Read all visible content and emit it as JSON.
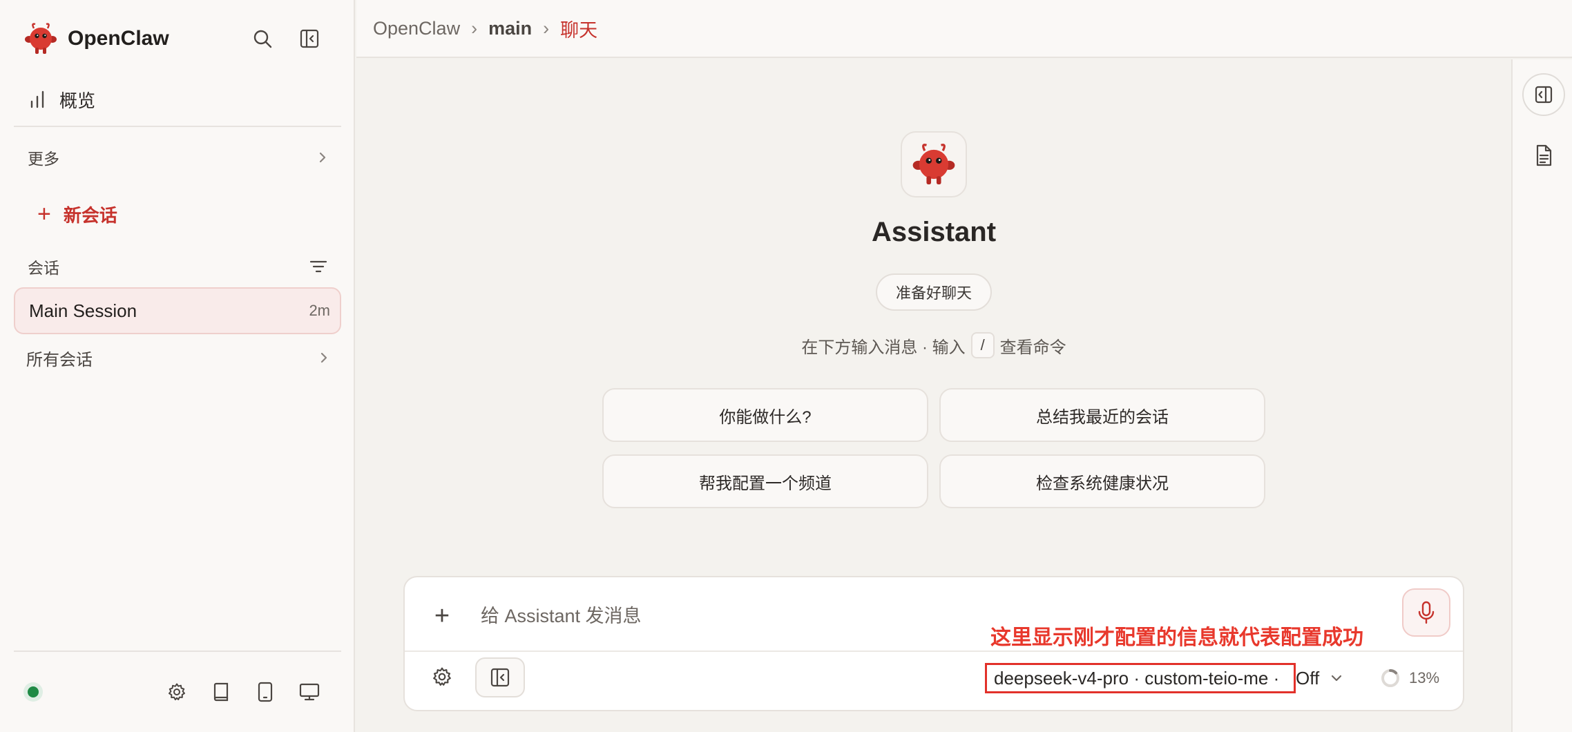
{
  "app": {
    "name": "OpenClaw"
  },
  "sidebar": {
    "overview_label": "概览",
    "more_label": "更多",
    "new_chat_label": "新会话",
    "sessions_header": "会话",
    "session": {
      "title": "Main Session",
      "age": "2m"
    },
    "all_sessions_label": "所有会话",
    "status_color": "#1f8a45"
  },
  "breadcrumb": {
    "root": "OpenClaw",
    "agent": "main",
    "page": "聊天"
  },
  "welcome": {
    "assistant_name": "Assistant",
    "status_pill": "准备好聊天",
    "hint_before": "在下方输入消息 · 输入",
    "hint_key": "/",
    "hint_after": "查看命令",
    "suggestions": [
      "你能做什么?",
      "总结我最近的会话",
      "帮我配置一个频道",
      "检查系统健康状况"
    ]
  },
  "composer": {
    "placeholder": "给 Assistant 发消息",
    "model_info": "deepseek-v4-pro · custom-teio-me ·",
    "thinking": "Off",
    "context_usage": "13%",
    "context_fraction": 0.13,
    "annotation": "这里显示刚才配置的信息就代表配置成功"
  },
  "colors": {
    "accent": "#c6322c",
    "annotation": "#e8382c"
  },
  "icons": [
    "openclaw-logo-icon",
    "search-icon",
    "sidebar-toggle-icon",
    "bar-chart-icon",
    "chevron-right-icon",
    "plus-icon",
    "filter-icon",
    "gear-icon",
    "book-icon",
    "tablet-icon",
    "monitor-icon",
    "panel-icon",
    "document-icon",
    "mic-icon",
    "chevron-down-icon",
    "progress-ring-icon"
  ]
}
